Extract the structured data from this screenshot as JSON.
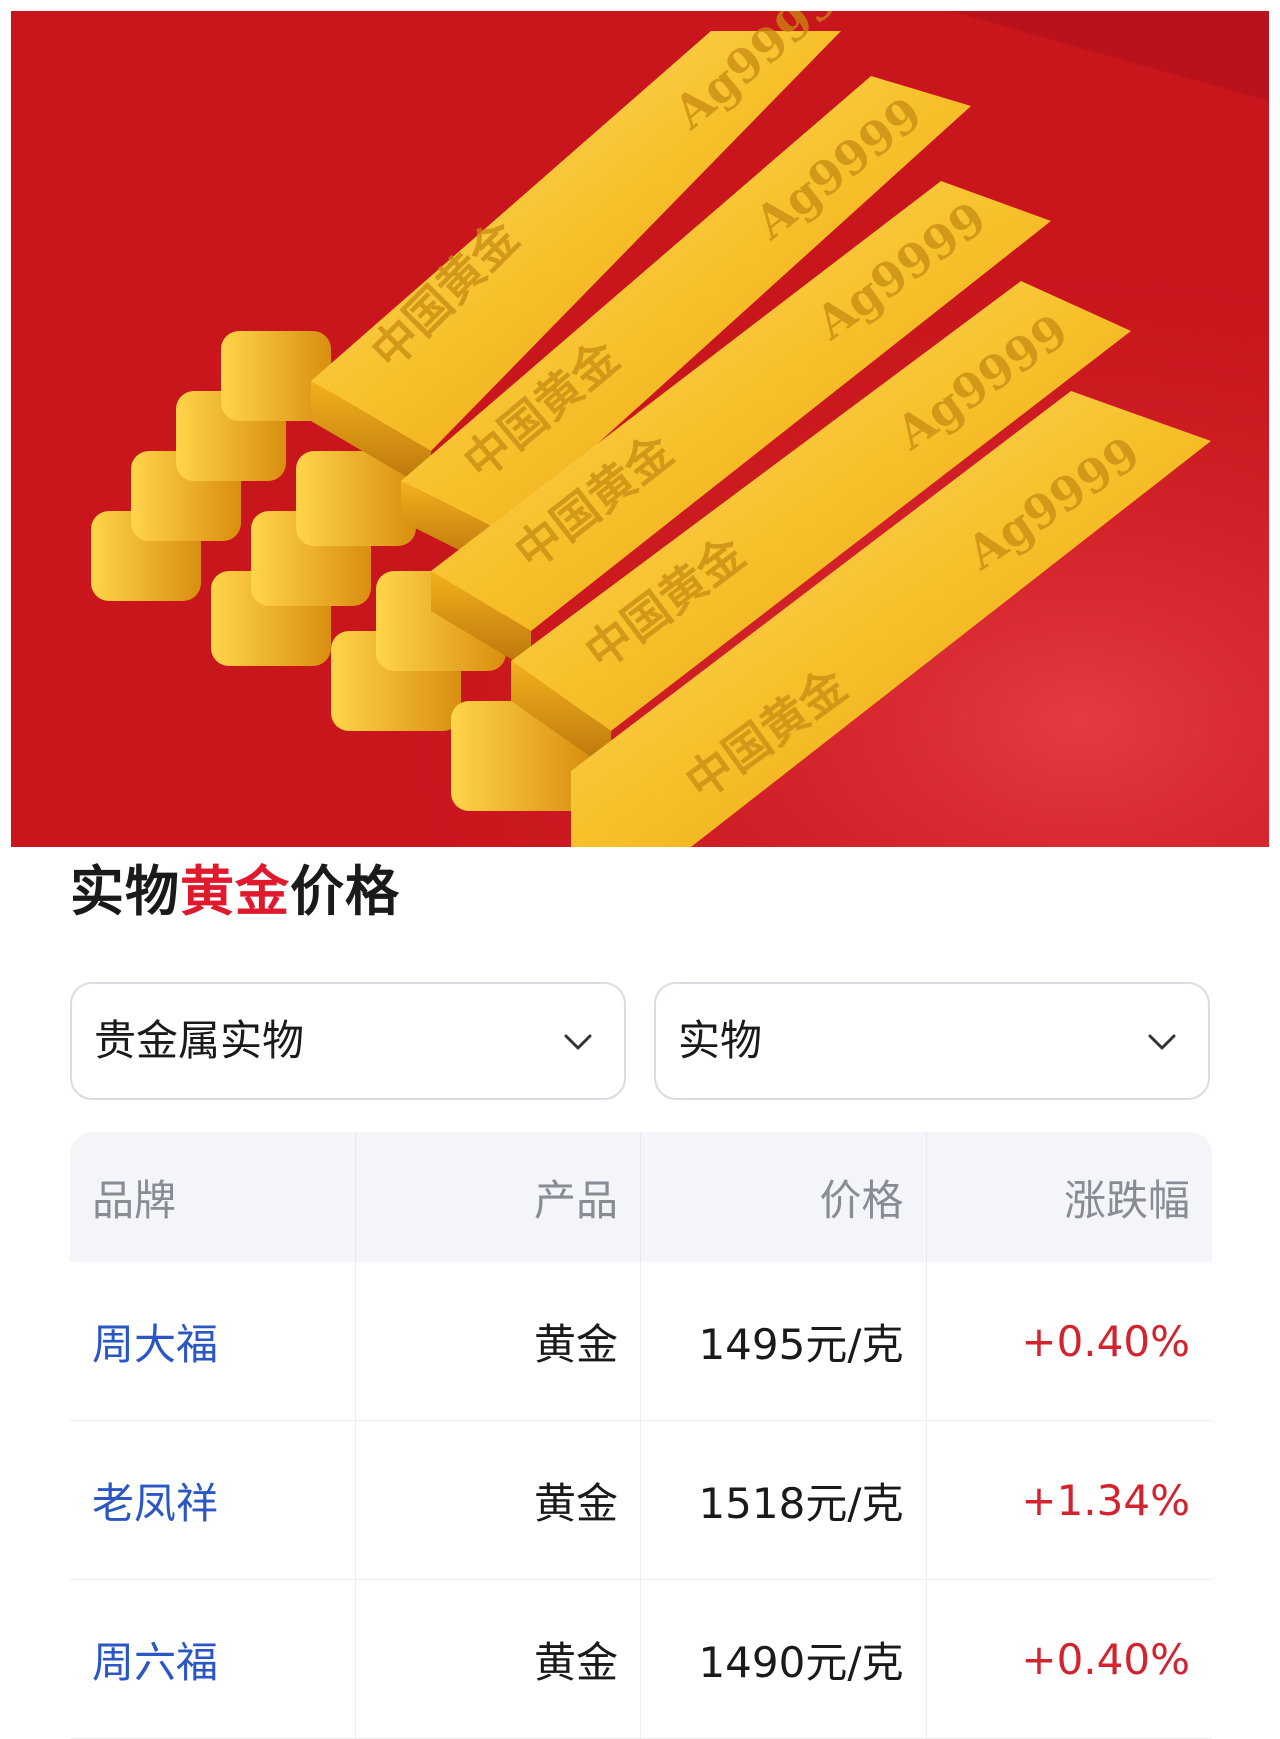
{
  "hero": {
    "bar_marks": [
      "中国黄金",
      "Ag9999"
    ]
  },
  "title": {
    "part1": "实物",
    "highlight": "黄金",
    "part2": "价格",
    "highlight_color": "#e0192d"
  },
  "filters": [
    {
      "value": "贵金属实物",
      "icon": "chevron-down-icon"
    },
    {
      "value": "实物",
      "icon": "chevron-down-icon"
    }
  ],
  "table": {
    "headers": [
      "品牌",
      "产品",
      "价格",
      "涨跌幅"
    ],
    "rows": [
      {
        "brand": "周大福",
        "product": "黄金",
        "price": "1495元/克",
        "change": "+0.40%"
      },
      {
        "brand": "老凤祥",
        "product": "黄金",
        "price": "1518元/克",
        "change": "+1.34%"
      },
      {
        "brand": "周六福",
        "product": "黄金",
        "price": "1490元/克",
        "change": "+0.40%"
      }
    ]
  },
  "colors": {
    "brand_link": "#2a56c6",
    "positive_change": "#d2232e",
    "header_bg": "#f3f5f9",
    "hero_bg": "#c8151b"
  }
}
